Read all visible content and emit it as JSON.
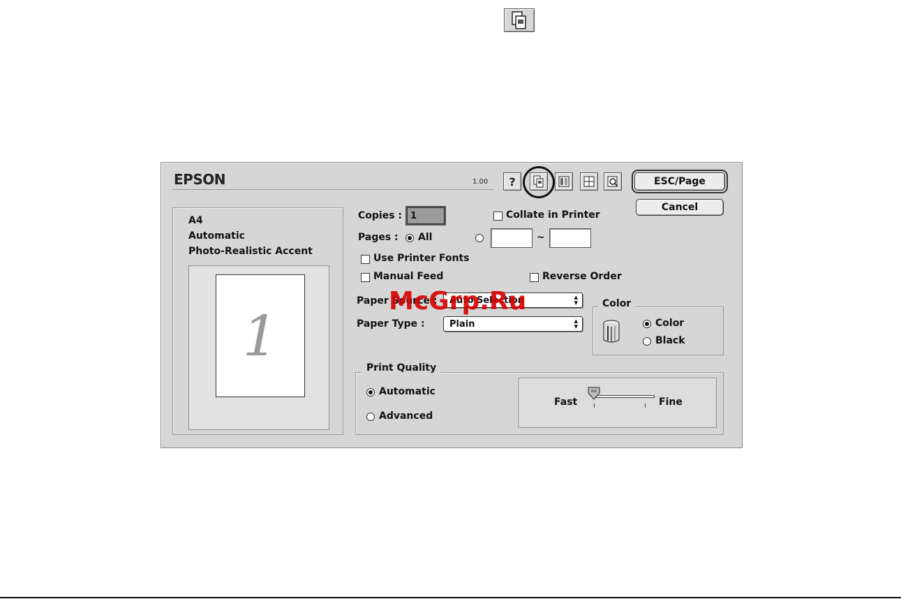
{
  "dialog": {
    "brand": "EPSON",
    "version": "1.00",
    "toolbar": {
      "help_label": "?"
    },
    "buttons": {
      "ok_label": "ESC/Page",
      "cancel_label": "Cancel"
    },
    "summary": {
      "paper": "A4",
      "mode": "Automatic",
      "setting": "Photo-Realistic Accent"
    },
    "preview": {
      "page_number": "1"
    },
    "copies": {
      "label": "Copies :",
      "value": "1"
    },
    "collate": {
      "label": "Collate in Printer",
      "checked": false
    },
    "pages": {
      "label": "Pages :",
      "all_label": "All",
      "range_separator": "~",
      "from": "",
      "to": ""
    },
    "options": {
      "use_printer_fonts": "Use Printer Fonts",
      "manual_feed": "Manual Feed",
      "reverse_order": "Reverse Order"
    },
    "paper_source": {
      "label": "Paper Source :",
      "value": "Auto Selection"
    },
    "paper_type": {
      "label": "Paper Type :",
      "value": "Plain"
    },
    "color_group": {
      "title": "Color",
      "color_label": "Color",
      "black_label": "Black",
      "selected": "Color"
    },
    "print_quality": {
      "title": "Print Quality",
      "automatic_label": "Automatic",
      "advanced_label": "Advanced",
      "selected": "Automatic",
      "slider": {
        "left_label": "Fast",
        "right_label": "Fine",
        "level": 0
      }
    }
  },
  "watermark": "McGrp.Ru"
}
